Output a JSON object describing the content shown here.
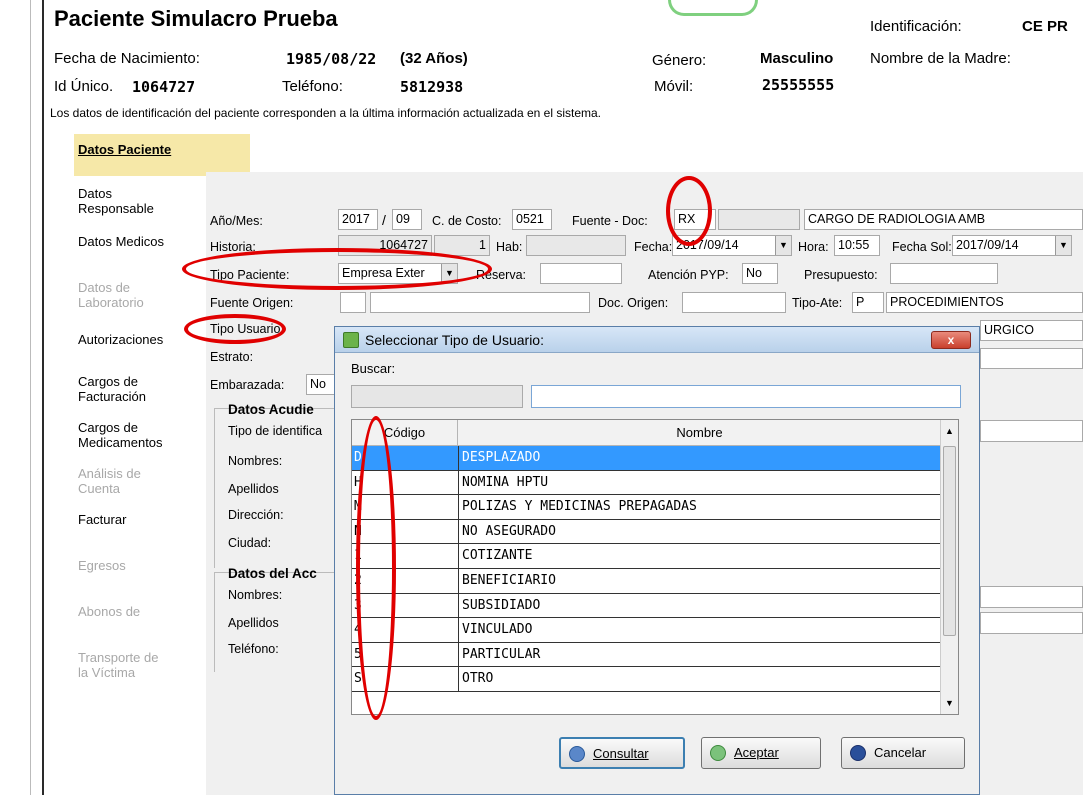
{
  "patient": {
    "name": "Paciente Simulacro Prueba",
    "identificacion_label": "Identificación:",
    "identificacion_value": "CE PR",
    "fecha_nac_label": "Fecha de Nacimiento:",
    "fecha_nac_value": "1985/08/22",
    "edad_value": "(32 Años)",
    "genero_label": "Género:",
    "genero_value": "Masculino",
    "madre_label": "Nombre de la Madre:",
    "id_unico_label": "Id Único.",
    "id_unico_value": "1064727",
    "telefono_label": "Teléfono:",
    "telefono_value": "5812938",
    "movil_label": "Móvil:",
    "movil_value": "25555555",
    "note": "Los datos de identificación del paciente corresponden a la última información actualizada en el sistema."
  },
  "sidebar": {
    "active": "Datos Paciente",
    "items": [
      {
        "label": "Datos\nResponsable",
        "enabled": true
      },
      {
        "label": "Datos Medicos",
        "enabled": true
      },
      {
        "label": "Datos de\nLaboratorio",
        "enabled": false
      },
      {
        "label": "Autorizaciones",
        "enabled": true
      },
      {
        "label": "Cargos de\nFacturación",
        "enabled": true
      },
      {
        "label": "Cargos de\nMedicamentos",
        "enabled": true
      },
      {
        "label": "Análisis de\nCuenta",
        "enabled": false
      },
      {
        "label": "Facturar",
        "enabled": true
      },
      {
        "label": "Egresos",
        "enabled": false
      },
      {
        "label": "Abonos de",
        "enabled": false
      },
      {
        "label": "Transporte de\nla Víctima",
        "enabled": false
      }
    ]
  },
  "form": {
    "anio_mes_label": "Año/Mes:",
    "anio_value": "2017",
    "mes_value": "09",
    "costo_label": "C. de Costo:",
    "costo_value": "0521",
    "fuente_doc_label": "Fuente - Doc:",
    "fuente_doc_value": "RX",
    "cargo_desc": "CARGO DE RADIOLOGIA AMB",
    "historia_label": "Historia:",
    "historia_value": "1064727",
    "historia_num": "1",
    "hab_label": "Hab:",
    "fecha_label": "Fecha:",
    "fecha_value": "2017/09/14",
    "hora_label": "Hora:",
    "hora_value": "10:55",
    "fecha_sol_label": "Fecha Sol:",
    "fecha_sol_value": "2017/09/14",
    "tipo_paciente_label": "Tipo Paciente:",
    "tipo_paciente_value": "Empresa Exter",
    "reserva_label": "Reserva:",
    "pyp_label": "Atención PYP:",
    "pyp_value": "No",
    "presupuesto_label": "Presupuesto:",
    "fuente_origen_label": "Fuente Origen:",
    "doc_origen_label": "Doc. Origen:",
    "tipo_ate_label": "Tipo-Ate:",
    "tipo_ate_value": "P",
    "tipo_ate_desc": "PROCEDIMIENTOS",
    "tipo_usuario_label": "Tipo Usuario:",
    "quirurgico_value": "URGICO",
    "estrato_label": "Estrato:",
    "embarazada_label": "Embarazada:",
    "embarazada_value": "No",
    "acudiente_title": "Datos Acudie",
    "tipo_ident_label": "Tipo de identifica",
    "nombres_label": "Nombres:",
    "apellidos_label": "Apellidos",
    "direccion_label": "Dirección:",
    "ciudad_label": "Ciudad:",
    "acompanante_title": "Datos del Acc",
    "nombres2_label": "Nombres:",
    "apellidos2_label": "Apellidos",
    "telefono2_label": "Teléfono:"
  },
  "dialog": {
    "title": "Seleccionar Tipo de Usuario:",
    "close_label": "x",
    "buscar_label": "Buscar:",
    "col_codigo": "Código",
    "col_nombre": "Nombre",
    "rows": [
      {
        "codigo": "D",
        "nombre": "DESPLAZADO",
        "selected": true
      },
      {
        "codigo": "H",
        "nombre": "NOMINA HPTU",
        "selected": false
      },
      {
        "codigo": "M",
        "nombre": "POLIZAS Y MEDICINAS PREPAGADAS",
        "selected": false
      },
      {
        "codigo": "N",
        "nombre": "NO ASEGURADO",
        "selected": false
      },
      {
        "codigo": "1",
        "nombre": "COTIZANTE",
        "selected": false
      },
      {
        "codigo": "2",
        "nombre": "BENEFICIARIO",
        "selected": false
      },
      {
        "codigo": "3",
        "nombre": "SUBSIDIADO",
        "selected": false
      },
      {
        "codigo": "4",
        "nombre": "VINCULADO",
        "selected": false
      },
      {
        "codigo": "5",
        "nombre": "PARTICULAR",
        "selected": false
      },
      {
        "codigo": "S",
        "nombre": "OTRO",
        "selected": false
      }
    ],
    "btn_consultar": "Consultar",
    "btn_aceptar": "Aceptar",
    "btn_cancelar": "Cancelar"
  },
  "colors": {
    "annotation_red": "#e00000",
    "selection_blue": "#3399ff",
    "active_tab_bg": "#f6e8a8"
  }
}
